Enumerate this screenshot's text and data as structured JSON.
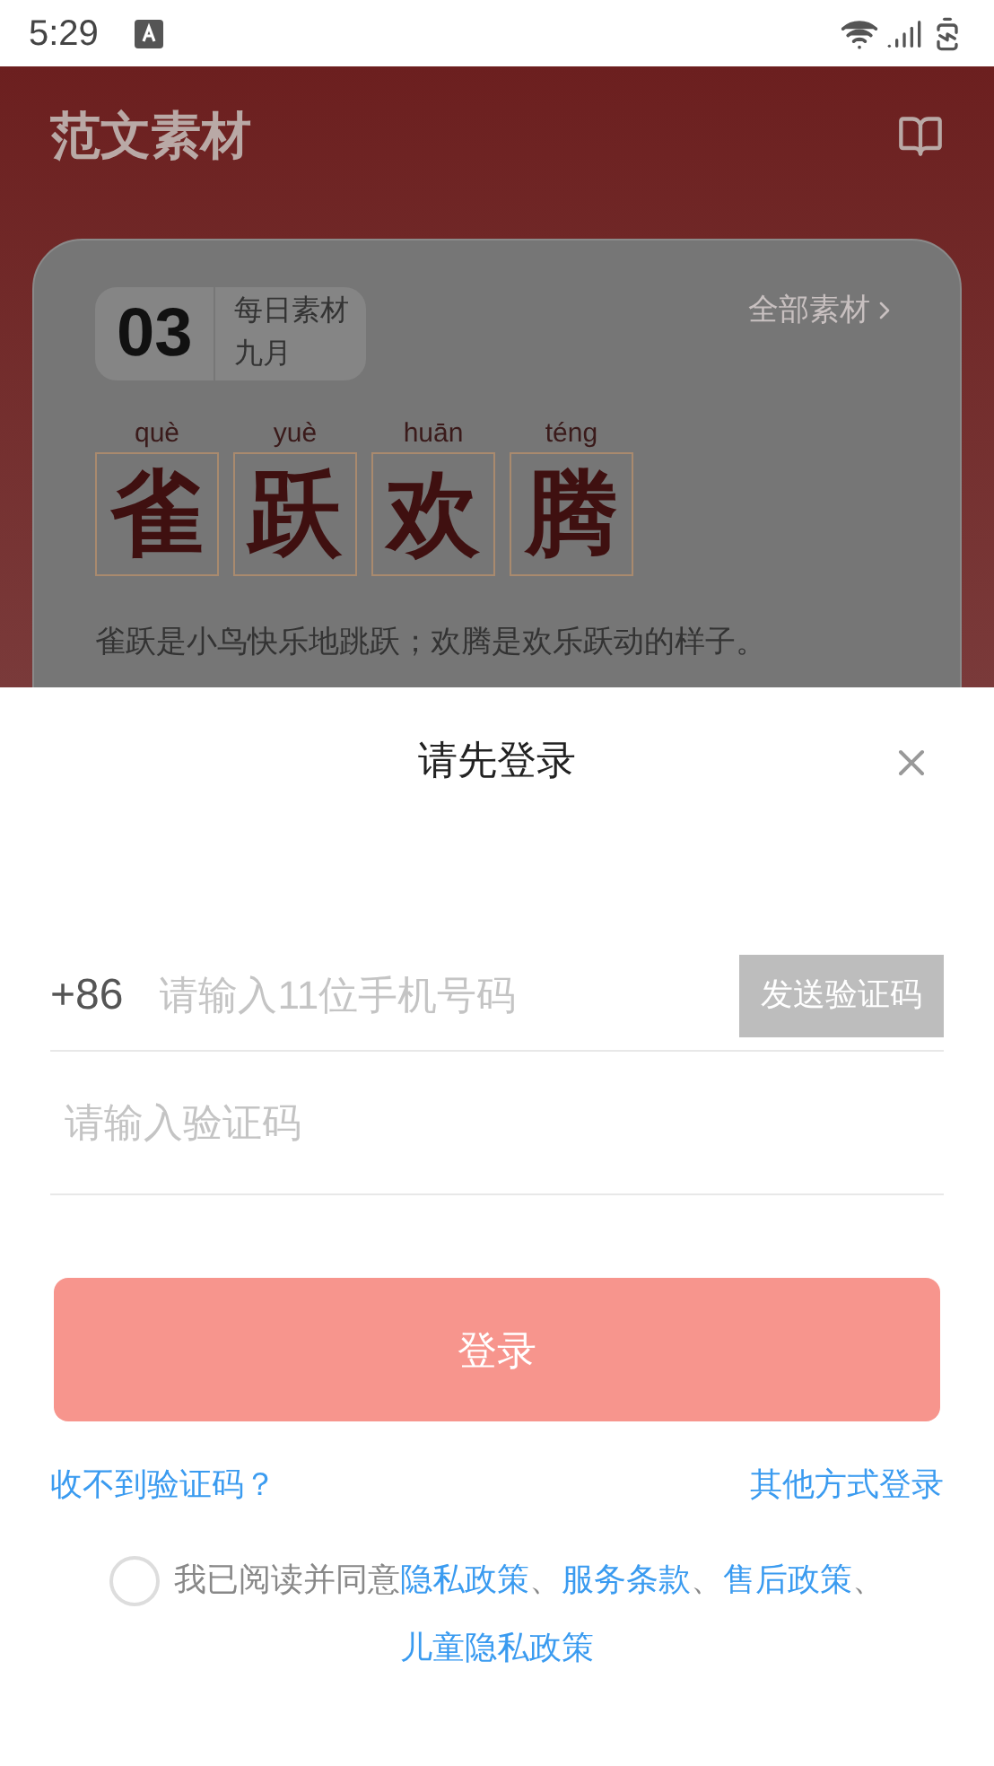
{
  "status_bar": {
    "time": "5:29"
  },
  "header": {
    "title": "范文素材"
  },
  "card": {
    "day": "03",
    "label": "每日素材",
    "month": "九月",
    "all_link": "全部素材",
    "chars": [
      {
        "pinyin": "què",
        "char": "雀"
      },
      {
        "pinyin": "yuè",
        "char": "跃"
      },
      {
        "pinyin": "huān",
        "char": "欢"
      },
      {
        "pinyin": "téng",
        "char": "腾"
      }
    ],
    "description": "雀跃是小鸟快乐地跳跃；欢腾是欢乐跃动的样子。"
  },
  "login": {
    "title": "请先登录",
    "phone": {
      "prefix": "+86",
      "placeholder": "请输入11位手机号码"
    },
    "send_code": {
      "label": "发送验证码",
      "disabled": true
    },
    "code": {
      "placeholder": "请输入验证码"
    },
    "submit": {
      "label": "登录",
      "disabled": true
    },
    "help_link": "收不到验证码？",
    "other_login": "其他方式登录",
    "agreement": {
      "checked": false,
      "intro": "我已阅读并同意",
      "links": [
        {
          "label": "隐私政策",
          "separator": "、"
        },
        {
          "label": "服务条款",
          "separator": "、"
        },
        {
          "label": "售后政策",
          "separator": "、"
        },
        {
          "label": "儿童隐私政策"
        }
      ]
    }
  }
}
